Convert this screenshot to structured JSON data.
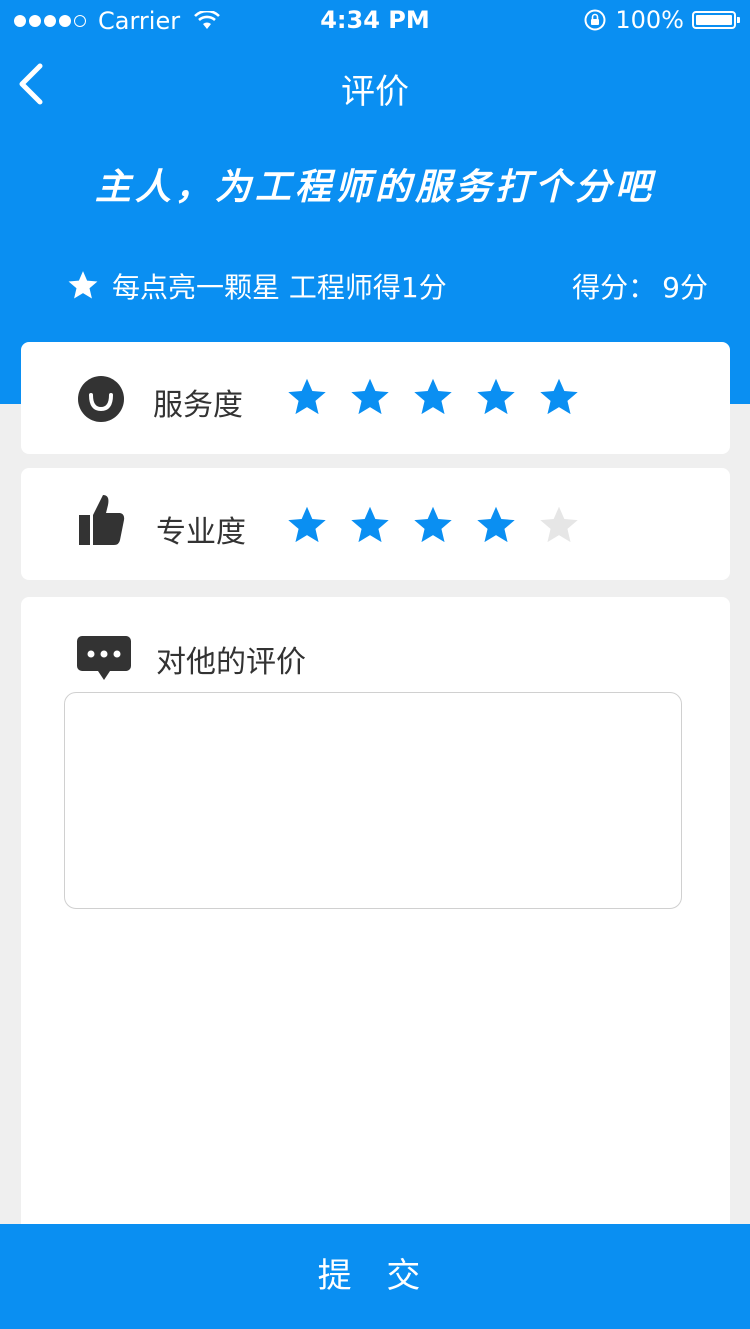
{
  "status_bar": {
    "carrier": "Carrier",
    "time": "4:34 PM",
    "battery": "100%",
    "signal_icon": "signal-dots-icon",
    "wifi_icon": "wifi-icon",
    "lock_icon": "orientation-lock-icon",
    "battery_icon": "battery-icon"
  },
  "nav": {
    "title": "评价",
    "back_icon": "chevron-left-icon"
  },
  "header": {
    "slogan": "主人，为工程师的服务打个分吧",
    "hint": "每点亮一颗星 工程师得1分",
    "score_label": "得分：",
    "score_value": "9分"
  },
  "ratings": [
    {
      "label": "服务度",
      "icon": "smile-icon",
      "stars": 5,
      "max": 5
    },
    {
      "label": "专业度",
      "icon": "thumbs-up-icon",
      "stars": 4,
      "max": 5
    }
  ],
  "comment": {
    "label": "对他的评价",
    "icon": "chat-bubble-icon",
    "value": "",
    "placeholder": ""
  },
  "submit_label": "提 交",
  "colors": {
    "accent": "#0a8ff2",
    "star_on": "#0a8ff2",
    "star_off": "#e6e6e6",
    "icon_dark": "#333333",
    "background": "#efefef"
  }
}
